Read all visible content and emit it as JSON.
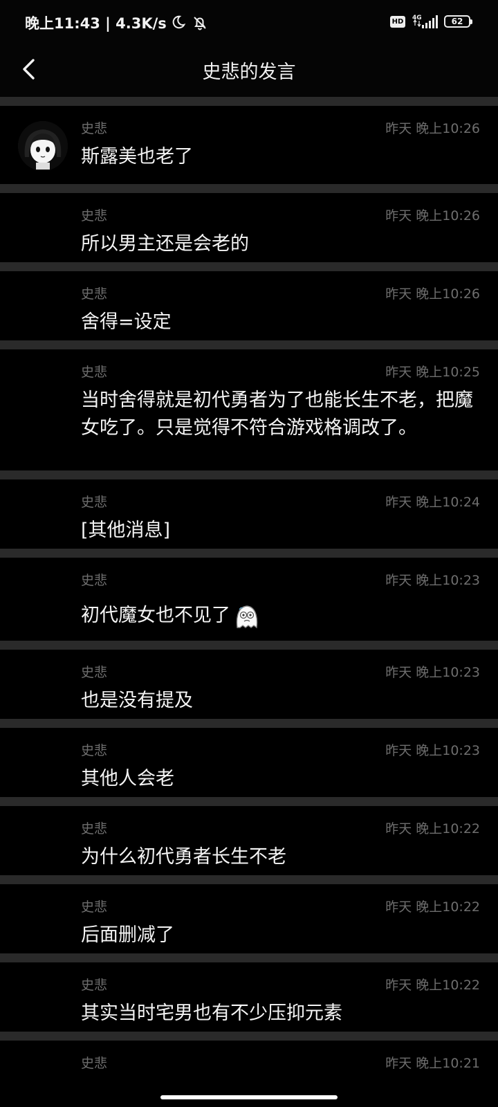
{
  "status_bar": {
    "time_speed": "晚上11:43 | 4.3K/s",
    "network": "4G",
    "battery": "62"
  },
  "header": {
    "title": "史悲的发言"
  },
  "messages": [
    {
      "sender": "史悲",
      "time": "昨天 晚上10:26",
      "text": "斯露美也老了"
    },
    {
      "sender": "史悲",
      "time": "昨天 晚上10:26",
      "text": "所以男主还是会老的"
    },
    {
      "sender": "史悲",
      "time": "昨天 晚上10:26",
      "text": "舍得=设定"
    },
    {
      "sender": "史悲",
      "time": "昨天 晚上10:25",
      "text": "当时舍得就是初代勇者为了也能长生不老，把魔女吃了。只是觉得不符合游戏格调改了。"
    },
    {
      "sender": "史悲",
      "time": "昨天 晚上10:24",
      "text": "[其他消息]"
    },
    {
      "sender": "史悲",
      "time": "昨天 晚上10:23",
      "text": "初代魔女也不见了"
    },
    {
      "sender": "史悲",
      "time": "昨天 晚上10:23",
      "text": "也是没有提及"
    },
    {
      "sender": "史悲",
      "time": "昨天 晚上10:23",
      "text": "其他人会老"
    },
    {
      "sender": "史悲",
      "time": "昨天 晚上10:22",
      "text": "为什么初代勇者长生不老"
    },
    {
      "sender": "史悲",
      "time": "昨天 晚上10:22",
      "text": "后面删减了"
    },
    {
      "sender": "史悲",
      "time": "昨天 晚上10:22",
      "text": "其实当时宅男也有不少压抑元素"
    },
    {
      "sender": "史悲",
      "time": "昨天 晚上10:21",
      "text": ""
    }
  ]
}
